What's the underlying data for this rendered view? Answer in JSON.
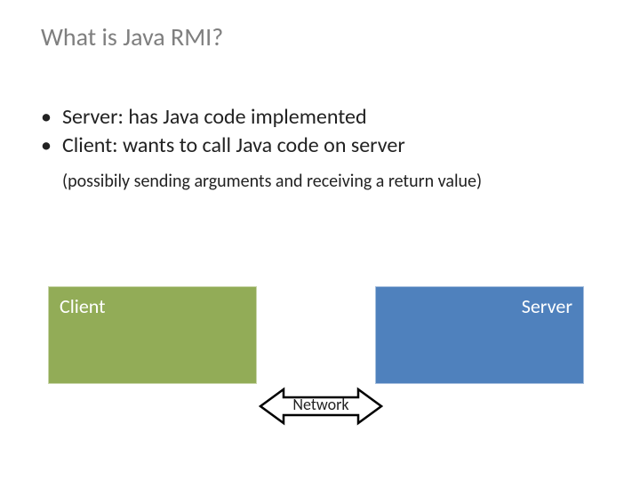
{
  "title": "What is Java RMI?",
  "bullets": {
    "items": [
      "Server: has Java code implemented",
      "Client: wants to call Java code on server"
    ],
    "subnote": "(possibily sending arguments and receiving a return value)"
  },
  "diagram": {
    "client_label": "Client",
    "server_label": "Server",
    "network_label": "Network"
  },
  "colors": {
    "title_gray": "#7f7f7f",
    "client_green": "#92ac57",
    "server_blue": "#4f81bd"
  }
}
